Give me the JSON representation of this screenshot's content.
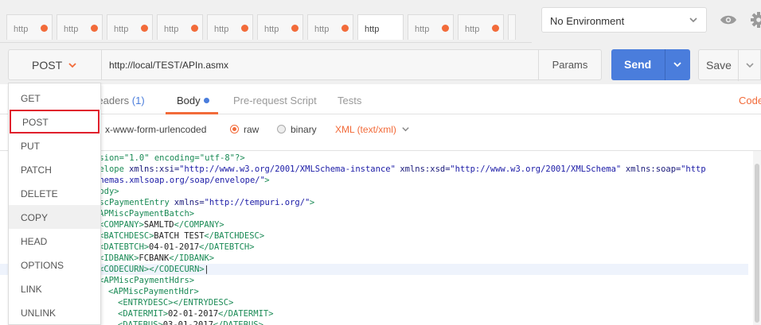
{
  "tabs": [
    {
      "label": "http"
    },
    {
      "label": "http"
    },
    {
      "label": "http"
    },
    {
      "label": "http"
    },
    {
      "label": "http"
    },
    {
      "label": "http"
    },
    {
      "label": "http"
    },
    {
      "label": "http"
    },
    {
      "label": "http"
    },
    {
      "label": "http"
    }
  ],
  "environment": {
    "selected": "No Environment"
  },
  "request": {
    "method": "POST",
    "url": "http://local/TEST/APIn.asmx",
    "params_label": "Params",
    "send_label": "Send",
    "save_label": "Save"
  },
  "request_tabs": {
    "headers_label": "Headers",
    "headers_count": "(1)",
    "body_label": "Body",
    "prerequest_label": "Pre-request Script",
    "tests_label": "Tests",
    "code_label": "Code"
  },
  "body_types": {
    "urlencoded": "x-www-form-urlencoded",
    "raw": "raw",
    "binary": "binary",
    "selected": "raw",
    "content_type": "XML (text/xml)"
  },
  "method_menu": [
    "GET",
    "POST",
    "PUT",
    "PATCH",
    "DELETE",
    "COPY",
    "HEAD",
    "OPTIONS",
    "LINK",
    "UNLINK"
  ],
  "method_menu_selected": "POST",
  "method_menu_hover": "COPY",
  "editor": {
    "lines": [
      [
        {
          "t": "rsion=\"1.0\" encoding=\"utf-8\"?>",
          "c": "c-tag"
        }
      ],
      [
        {
          "t": "velope ",
          "c": "c-tag"
        },
        {
          "t": "xmlns:xsi=",
          "c": "c-attr"
        },
        {
          "t": "\"http://www.w3.org/2001/XMLSchema-instance\"",
          "c": "c-val"
        },
        {
          "t": " xmlns:xsd=",
          "c": "c-attr"
        },
        {
          "t": "\"http://www.w3.org/2001/XMLSchema\"",
          "c": "c-val"
        },
        {
          "t": " xmlns:soap=",
          "c": "c-attr"
        },
        {
          "t": "\"http",
          "c": "c-val"
        }
      ],
      [
        {
          "t": "chemas.xmlsoap.org/soap/envelope/\"",
          "c": "c-val"
        },
        {
          "t": ">",
          "c": "c-tag"
        }
      ],
      [
        {
          "t": "Body>",
          "c": "c-tag"
        }
      ],
      [
        {
          "t": "iscPaymentEntry ",
          "c": "c-tag"
        },
        {
          "t": "xmlns=",
          "c": "c-attr"
        },
        {
          "t": "\"http://tempuri.org/\"",
          "c": "c-val"
        },
        {
          "t": ">",
          "c": "c-tag"
        }
      ],
      [
        {
          "t": "APMiscPaymentBatch>",
          "c": "c-tag"
        }
      ],
      [
        {
          "t": "<COMPANY>",
          "c": "c-tag"
        },
        {
          "t": "SAMLTD",
          "c": "c-text"
        },
        {
          "t": "</COMPANY>",
          "c": "c-tag"
        }
      ],
      [
        {
          "t": "<BATCHDESC>",
          "c": "c-tag"
        },
        {
          "t": "BATCH TEST",
          "c": "c-text"
        },
        {
          "t": "</BATCHDESC>",
          "c": "c-tag"
        }
      ],
      [
        {
          "t": "<DATEBTCH>",
          "c": "c-tag"
        },
        {
          "t": "04-01-2017",
          "c": "c-text"
        },
        {
          "t": "</DATEBTCH>",
          "c": "c-tag"
        }
      ],
      [
        {
          "t": "<IDBANK>",
          "c": "c-tag"
        },
        {
          "t": "FCBANK",
          "c": "c-text"
        },
        {
          "t": "</IDBANK>",
          "c": "c-tag"
        }
      ],
      [
        {
          "t": "<CODECURN></CODECURN>",
          "c": "c-tag"
        },
        {
          "t": "|",
          "c": "c-text"
        }
      ],
      [
        {
          "t": "<APMiscPaymentHdrs>",
          "c": "c-tag"
        }
      ],
      [
        {
          "t": "<APMiscPaymentHdr>",
          "c": "c-tag"
        }
      ],
      [
        {
          "t": "<ENTRYDESC></ENTRYDESC>",
          "c": "c-tag"
        }
      ],
      [
        {
          "t": "<DATERMIT>",
          "c": "c-tag"
        },
        {
          "t": "02-01-2017",
          "c": "c-text"
        },
        {
          "t": "</DATERMIT>",
          "c": "c-tag"
        }
      ],
      [
        {
          "t": "<DATEBUS>",
          "c": "c-tag"
        },
        {
          "t": "03-01-2017",
          "c": "c-text"
        },
        {
          "t": "</DATEBUS>",
          "c": "c-tag"
        }
      ]
    ]
  },
  "colors": {
    "accent": "#f26b3a",
    "send": "#4a7ddc",
    "selection_box": "#e0202c"
  }
}
